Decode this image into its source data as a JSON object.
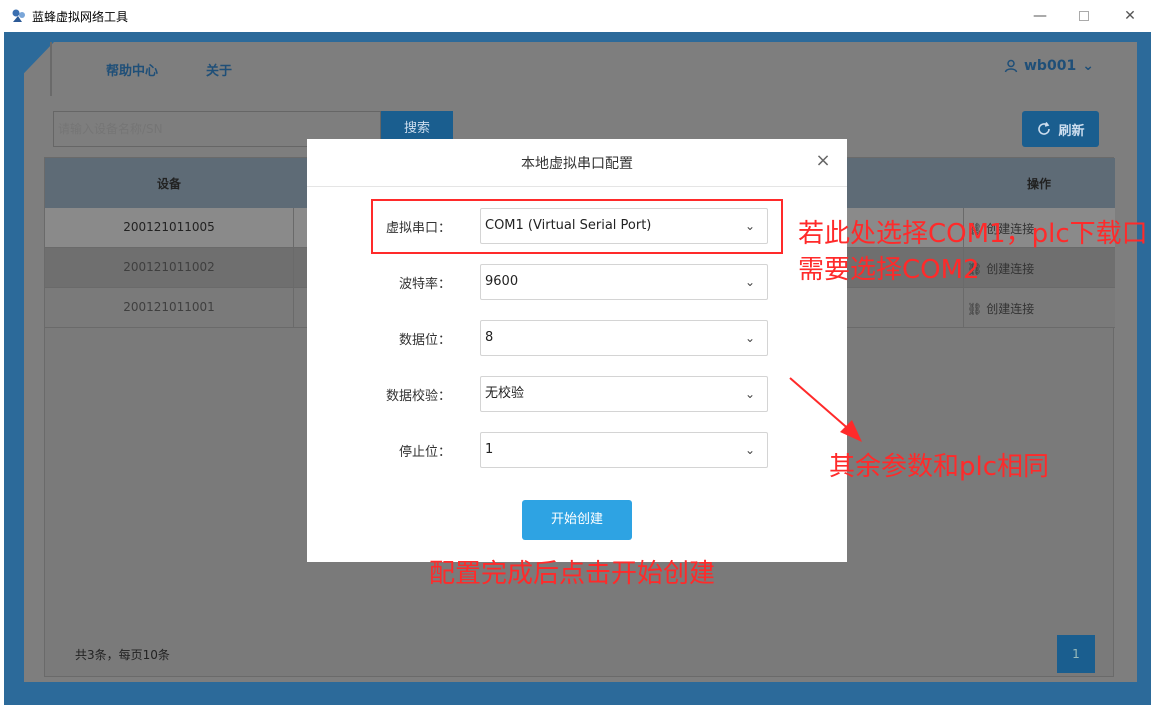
{
  "window": {
    "title": "蓝蜂虚拟网络工具",
    "minimize": "—",
    "close": "✕"
  },
  "header": {
    "nav": [
      "帮助中心",
      "关于"
    ],
    "user": "wb001"
  },
  "search": {
    "placeholder": "请输入设备名称/SN",
    "button": "搜索"
  },
  "refresh": {
    "label": "刷新"
  },
  "table": {
    "columns": [
      "设备",
      "操作"
    ],
    "rows": [
      {
        "sn": "200121011005",
        "op": "创建连接"
      },
      {
        "sn": "200121011002",
        "op": "创建连接"
      },
      {
        "sn": "200121011001",
        "op": "创建连接"
      }
    ],
    "footer": "共3条，每页10条",
    "page": "1"
  },
  "modal": {
    "title": "本地虚拟串口配置",
    "close": "×",
    "fields": [
      {
        "label": "虚拟串口：",
        "value": "COM1 (Virtual Serial Port)"
      },
      {
        "label": "波特率：",
        "value": "9600"
      },
      {
        "label": "数据位：",
        "value": "8"
      },
      {
        "label": "数据校验：",
        "value": "无校验"
      },
      {
        "label": "停止位：",
        "value": "1"
      }
    ],
    "submit": "开始创建"
  },
  "annotations": {
    "note1": "若此处选择COM1，plc下载口需要选择COM2",
    "note2": "其余参数和plc相同",
    "note3": "配置完成后点击开始创建",
    "color": "#ff2a2a"
  }
}
